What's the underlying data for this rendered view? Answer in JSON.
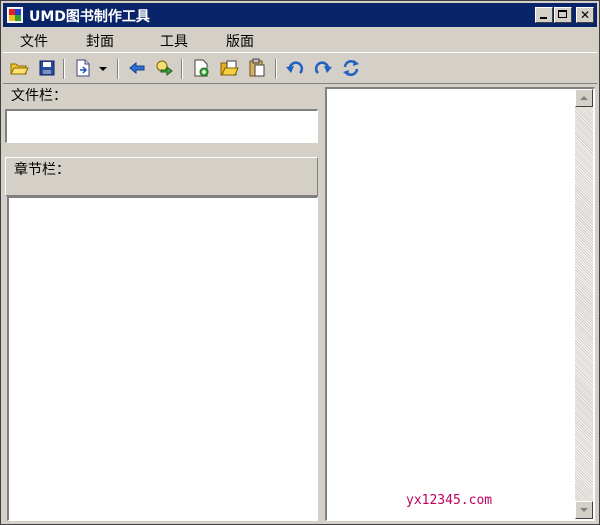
{
  "window": {
    "title": "UMD图书制作工具"
  },
  "menu": [
    {
      "label": "文件"
    },
    {
      "label": "封面"
    },
    {
      "label": "工具"
    },
    {
      "label": "版面"
    }
  ],
  "toolbar": {
    "icons": [
      "open-folder-icon",
      "save-icon",
      "new-document-icon",
      "dropdown-arrow-icon",
      "back-arrow-icon",
      "forward-arrow-icon",
      "add-page-icon",
      "folder-page-icon",
      "paste-icon",
      "undo-icon",
      "redo-icon",
      "refresh-icon"
    ]
  },
  "file_panel": {
    "label": "文件栏：",
    "value": ""
  },
  "chapter_panel": {
    "label": "章节栏："
  },
  "watermark": "yx12345.com",
  "colors": {
    "titlebar": "#0a246a",
    "chrome": "#d4d0c8",
    "watermark": "#c00060"
  }
}
